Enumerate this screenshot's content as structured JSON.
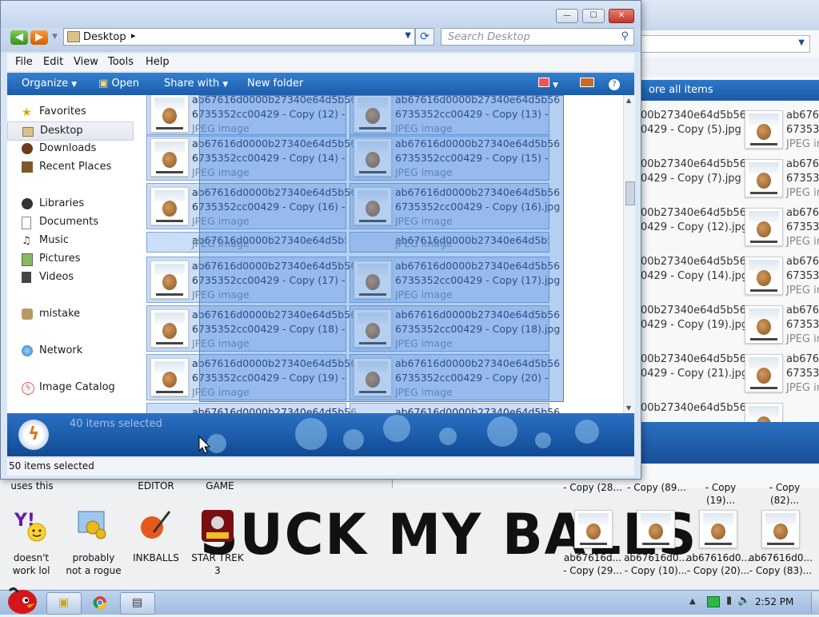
{
  "window": {
    "title_buttons": {
      "minimize": "—",
      "maximize": "☐",
      "close": "✕"
    },
    "address": {
      "location": "Desktop",
      "separator": "▸"
    },
    "search_placeholder": "Search Desktop"
  },
  "menu": [
    "File",
    "Edit",
    "View",
    "Tools",
    "Help"
  ],
  "toolbar": {
    "organize": "Organize",
    "open": "Open",
    "share_with": "Share with",
    "new_folder": "New folder"
  },
  "nav": {
    "favorites": "Favorites",
    "desktop": "Desktop",
    "downloads": "Downloads",
    "recent_places": "Recent Places",
    "libraries": "Libraries",
    "documents": "Documents",
    "music": "Music",
    "pictures": "Pictures",
    "videos": "Videos",
    "mistake": "mistake",
    "network": "Network",
    "image_catalog": "Image Catalog"
  },
  "files": {
    "line1": "ab67616d0000b27340e64d5b56",
    "type": "JPEG image",
    "rows": [
      {
        "left": "6735352cc00429 - Copy (12) -",
        "right": "6735352cc00429 - Copy (13) -"
      },
      {
        "left": "6735352cc00429 - Copy (14) -",
        "right": "6735352cc00429 - Copy (15) -"
      },
      {
        "left": "6735352cc00429 - Copy (16) -",
        "right": "6735352cc00429 - Copy (16).jpg"
      },
      {
        "left": "",
        "right": ""
      },
      {
        "left": "6735352cc00429 - Copy (17) -",
        "right": "6735352cc00429 - Copy (17).jpg"
      },
      {
        "left": "6735352cc00429 - Copy (18) -",
        "right": "6735352cc00429 - Copy (18).jpg"
      },
      {
        "left": "6735352cc00429 - Copy (19) -",
        "right": "6735352cc00429 - Copy (20) -"
      },
      {
        "left": "",
        "right": ""
      }
    ]
  },
  "details": {
    "selected": "40 items selected"
  },
  "status": {
    "text": "50 items selected"
  },
  "bg_window": {
    "toolbar_text": "ore all items",
    "line1": "00b27340e64d5b56",
    "items": [
      "0429 - Copy (5).jpg",
      "0429 - Copy (7).jpg",
      "0429 - Copy (12).jpg",
      "0429 - Copy (14).jpg",
      "0429 - Copy (19).jpg",
      "0429 - Copy (21).jpg"
    ],
    "right_col": [
      "ab6761",
      "673535",
      "JPEG in"
    ]
  },
  "desktop": {
    "top_labels": [
      "uses this",
      "EDITOR",
      "GAME"
    ],
    "big_text": "SUCK MY BALLS",
    "icons": [
      {
        "line1": "doesn't",
        "line2": "work lol"
      },
      {
        "line1": "probably",
        "line2": "not a rogue"
      },
      {
        "line1": "INKBALLS",
        "line2": ""
      },
      {
        "line1": "STAR TREK",
        "line2": "3"
      }
    ],
    "file_top": [
      "- Copy (28...",
      "- Copy (89...",
      "- Copy (19)...",
      "- Copy (82)..."
    ],
    "file_icons": [
      {
        "line1": "ab67616d...",
        "line2": "- Copy (29..."
      },
      {
        "line1": "ab67616d0...",
        "line2": "- Copy (10)..."
      },
      {
        "line1": "ab67616d0...",
        "line2": "- Copy (20)..."
      },
      {
        "line1": "ab67616d0...",
        "line2": "- Copy (83)..."
      }
    ]
  },
  "taskbar": {
    "clock": "2:52 PM"
  }
}
